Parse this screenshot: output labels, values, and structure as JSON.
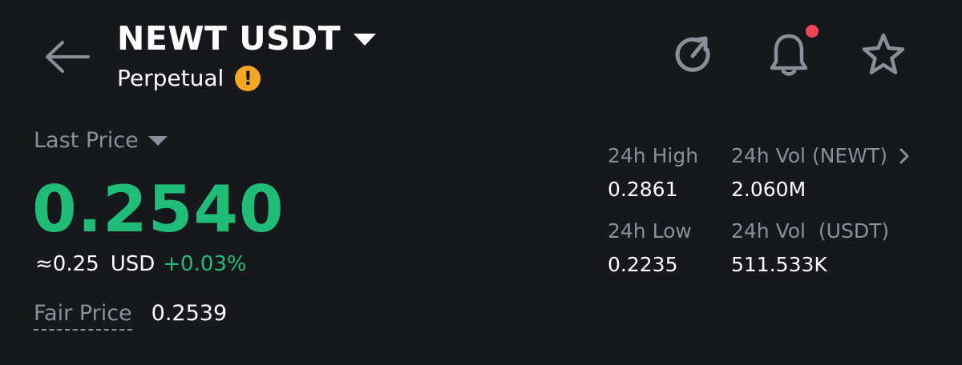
{
  "header": {
    "symbol": "NEWT USDT",
    "contract_type": "Perpetual",
    "warning_glyph": "!",
    "icons": {
      "back": "arrow-left-icon",
      "symbol_dropdown": "caret-down-icon",
      "warning": "warning-icon",
      "refresh": "refresh-icon",
      "notifications": "bell-icon",
      "favorite": "star-icon"
    },
    "has_notification": true
  },
  "price": {
    "label": "Last Price",
    "last": "0.2540",
    "usd_approx": "≈0.25",
    "usd_unit": "USD",
    "change": "+0.03%",
    "fair_label": "Fair Price",
    "fair_value": "0.2539"
  },
  "stats": {
    "high_label": "24h High",
    "high_value": "0.2861",
    "vol_base_label": "24h Vol (NEWT)",
    "vol_base_value": "2.060M",
    "low_label": "24h Low",
    "low_value": "0.2235",
    "vol_quote_label": "24h Vol  (USDT)",
    "vol_quote_value": "511.533K"
  },
  "colors": {
    "background": "#17181c",
    "up": "#1fbd78",
    "muted": "#8a8f99",
    "warning": "#f5a623",
    "notification": "#f0445a"
  }
}
